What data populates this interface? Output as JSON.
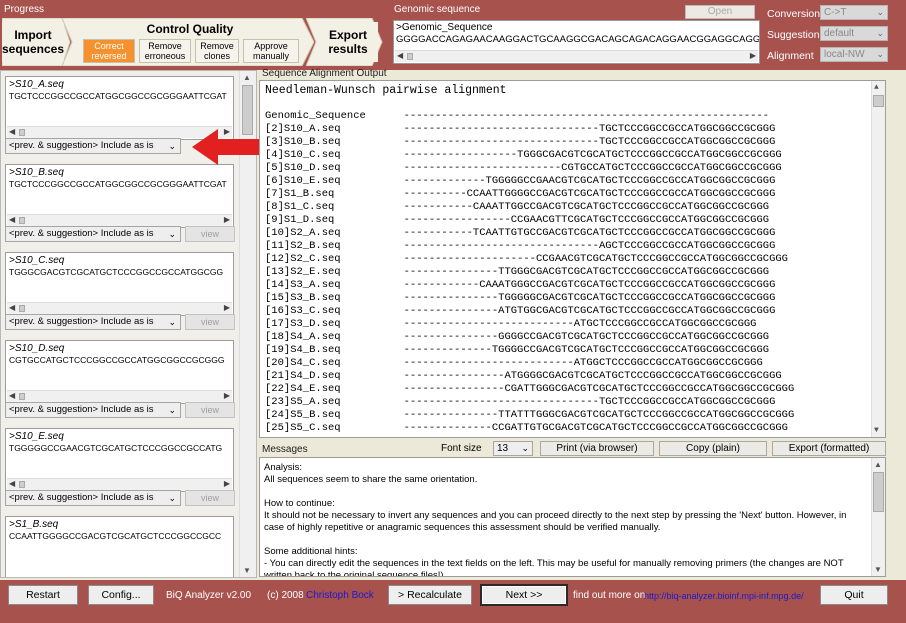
{
  "progress": {
    "title": "Progress",
    "import_line1": "Import",
    "import_line2": "sequences",
    "control_quality": "Control Quality",
    "correct_line1": "Correct",
    "correct_line2": "reversed",
    "remove_err_line1": "Remove",
    "remove_err_line2": "erroneous",
    "remove_clones_line1": "Remove",
    "remove_clones_line2": "clones",
    "approve_line1": "Approve",
    "approve_line2": "manually",
    "export_line1": "Export",
    "export_line2": "results"
  },
  "genomic": {
    "title": "Genomic sequence",
    "open_label": "Open",
    "name": ">Genomic_Sequence",
    "sequence": "GGGGACCAGAGAACAAGGACTGCAAGGCGACAGCAGACAGGAACGGAGGCAGG"
  },
  "settings": {
    "conversion_label": "Conversion",
    "conversion_value": "C->T",
    "suggestions_label": "Suggestions",
    "suggestions_value": "default",
    "alignment_label": "Alignment",
    "alignment_value": "local-NW"
  },
  "sequences": [
    {
      "name": ">S10_A.seq",
      "seq": "TGCTCCCGGCCGCCATGGCGGCCGCGGGAATTCGAT"
    },
    {
      "name": ">S10_B.seq",
      "seq": "TGCTCCCGGCCGCCATGGCGGCCGCGGGAATTCGAT"
    },
    {
      "name": ">S10_C.seq",
      "seq": "TGGGCGACGTCGCATGCTCCCGGCCGCCATGGCGG"
    },
    {
      "name": ">S10_D.seq",
      "seq": "CGTGCCATGCTCCCGGCCGCCATGGCGGCCGCGGG"
    },
    {
      "name": ">S10_E.seq",
      "seq": "TGGGGGCCGAACGTCGCATGCTCCCGGCCGCCATG"
    },
    {
      "name": ">S1_B.seq",
      "seq": "CCAATTGGGGCCGACGTCGCATGCTCCCGGCCGCC"
    }
  ],
  "seq_controls": {
    "include_label": "<prev. & suggestion> Include as is",
    "view_label": "view"
  },
  "alignment": {
    "title": "Sequence Alignment Output",
    "header": "Needleman-Wunsch pairwise alignment",
    "genomic_line": "Genomic_Sequence      ----------------------------------------------------------",
    "rows": [
      "[2]S10_A.seq          -------------------------------TGCTCCCGGCCGCCATGGCGGCCGCGGG",
      "[3]S10_B.seq          -------------------------------TGCTCCCGGCCGCCATGGCGGCCGCGGG",
      "[4]S10_C.seq          ------------------TGGGCGACGTCGCATGCTCCCGGCCGCCATGGCGGCCGCGGG",
      "[5]S10_D.seq          -------------------------CGTGCCATGCTCCCGGCCGCCATGGCGGCCGCGGG",
      "[6]S10_E.seq          -------------TGGGGGCCGAACGTCGCATGCTCCCGGCCGCCATGGCGGCCGCGGG",
      "[7]S1_B.seq           ----------CCAATTGGGGCCGACGTCGCATGCTCCCGGCCGCCATGGCGGCCGCGGG",
      "[8]S1_C.seq           -----------CAAATTGGCCGACGTCGCATGCTCCCGGCCGCCATGGCGGCCGCGGG",
      "[9]S1_D.seq           -----------------CCGAACGTTCGCATGCTCCCGGCCGCCATGGCGGCCGCGGG",
      "[10]S2_A.seq          -----------TCAATTGTGCCGACGTCGCATGCTCCCGGCCGCCATGGCGGCCGCGGG",
      "[11]S2_B.seq          -------------------------------AGCTCCCGGCCGCCATGGCGGCCGCGGG",
      "[12]S2_C.seq          ---------------------CCGAACGTCGCATGCTCCCGGCCGCCATGGCGGCCGCGGG",
      "[13]S2_E.seq          ---------------TTGGGCGACGTCGCATGCTCCCGGCCGCCATGGCGGCCGCGGG",
      "[14]S3_A.seq          ------------CAAATGGGCCGACGTCGCATGCTCCCGGCCGCCATGGCGGCCGCGGG",
      "[15]S3_B.seq          ---------------TGGGGGCGACGTCGCATGCTCCCGGCCGCCATGGCGGCCGCGGG",
      "[16]S3_C.seq          ---------------ATGTGGCGACGTCGCATGCTCCCGGCCGCCATGGCGGCCGCGGG",
      "[17]S3_D.seq          ---------------------------ATGCTCCCGGCCGCCATGGCGGCCGCGGG",
      "[18]S4_A.seq          ---------------GGGGCCGACGTCGCATGCTCCCGGCCGCCATGGCGGCCGCGGG",
      "[19]S4_B.seq          --------------TGGGGCCGACGTCGCATGCTCCCGGCCGCCATGGCGGCCGCGGG",
      "[20]S4_C.seq          ---------------------------ATGGCTCCCGGCCGCCATGGCGGCCGCGGG",
      "[21]S4_D.seq          ----------------ATGGGGCGACGTCGCATGCTCCCGGCCGCCATGGCGGCCGCGGG",
      "[22]S4_E.seq          ----------------CGATTGGGCGACGTCGCATGCTCCCGGCCGCCATGGCGGCCGCGGG",
      "[23]S5_A.seq          -------------------------------TGCTCCCGGCCGCCATGGCGGCCGCGGG",
      "[24]S5_B.seq          ---------------TTATTTGGGCGACGTCGCATGCTCCCGGCCGCCATGGCGGCCGCGGG",
      "[25]S5_C.seq          --------------CCGATTGTGCGACGTCGCATGCTCCCGGCCGCCATGGCGGCCGCGGG"
    ]
  },
  "messages": {
    "title": "Messages",
    "font_size_label": "Font size",
    "font_size_value": "13",
    "print_label": "Print (via browser)",
    "copy_label": "Copy (plain)",
    "export_label": "Export (formatted)",
    "lines": [
      "Analysis:",
      "All sequences seem to share the same orientation.",
      "",
      "How to continue:",
      "It should not be necessary to invert any sequences and you can proceed directly to the next step by pressing the 'Next' button. However, in",
      "case of highly repetitive or anagramic sequences this assessment should be verified manually.",
      "",
      "Some additional hints:",
      "- You can directly edit the sequences in the text fields on the left. This may be useful for manually removing primers (the changes are NOT",
      "written back to the original sequence files!)"
    ]
  },
  "bottom": {
    "restart": "Restart",
    "config": "Config...",
    "version": "BiQ Analyzer v2.00",
    "copyright": "(c) 2008",
    "author": "Christoph Bock",
    "recalculate": "> Recalculate",
    "next": "Next >>",
    "findout": "find out more on",
    "url": "http://biq-analyzer.bioinf.mpi-inf.mpg.de/",
    "quit": "Quit"
  },
  "colors": {
    "bar": "#a8524e",
    "active_step": "#f5922f",
    "arrow": "#e32020",
    "link": "#1a1acc"
  }
}
